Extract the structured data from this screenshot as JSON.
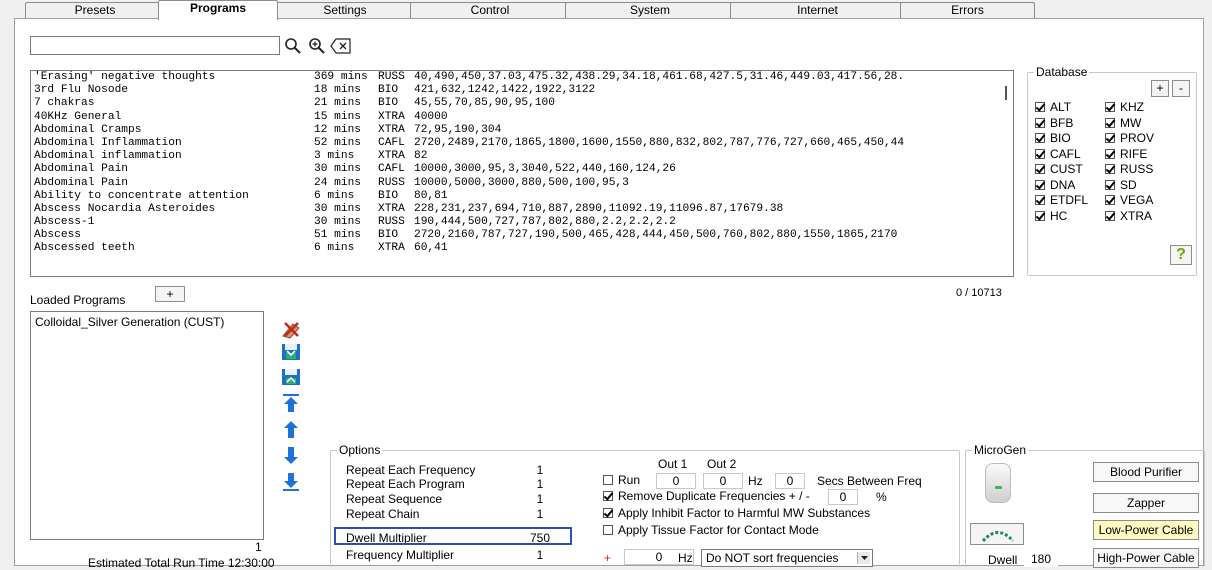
{
  "tabs": [
    {
      "label": "Presets"
    },
    {
      "label": "Programs"
    },
    {
      "label": "Settings"
    },
    {
      "label": "Control"
    },
    {
      "label": "System"
    },
    {
      "label": "Internet"
    },
    {
      "label": "Errors"
    }
  ],
  "search": {
    "value": "",
    "placeholder": ""
  },
  "programs": [
    {
      "name": "'Erasing' negative thoughts",
      "time": "369 mins",
      "db": "RUSS",
      "freqs": "40,490,450,37.03,475.32,438.29,34.18,461.68,427.5,31.46,449.03,417.56,28."
    },
    {
      "name": "3rd Flu Nosode",
      "time": "18 mins",
      "db": "BIO",
      "freqs": "421,632,1242,1422,1922,3122"
    },
    {
      "name": "7 chakras",
      "time": "21 mins",
      "db": "BIO",
      "freqs": "45,55,70,85,90,95,100"
    },
    {
      "name": "40KHz General",
      "time": "15 mins",
      "db": "XTRA",
      "freqs": "40000"
    },
    {
      "name": "Abdominal Cramps",
      "time": "12 mins",
      "db": "XTRA",
      "freqs": "72,95,190,304"
    },
    {
      "name": "Abdominal Inflammation",
      "time": "52 mins",
      "db": "CAFL",
      "freqs": "2720,2489,2170,1865,1800,1600,1550,880,832,802,787,776,727,660,465,450,44"
    },
    {
      "name": "Abdominal inflammation",
      "time": "3 mins",
      "db": "XTRA",
      "freqs": "82"
    },
    {
      "name": "Abdominal Pain",
      "time": "30 mins",
      "db": "CAFL",
      "freqs": "10000,3000,95,3,3040,522,440,160,124,26"
    },
    {
      "name": "Abdominal Pain",
      "time": "24 mins",
      "db": "RUSS",
      "freqs": "10000,5000,3000,880,500,100,95,3"
    },
    {
      "name": "Ability to concentrate attention",
      "time": "6 mins",
      "db": "BIO",
      "freqs": "80,81"
    },
    {
      "name": "Abscess Nocardia Asteroides",
      "time": "30 mins",
      "db": "XTRA",
      "freqs": "228,231,237,694,710,887,2890,11092.19,11096.87,17679.38"
    },
    {
      "name": "Abscess-1",
      "time": "30 mins",
      "db": "RUSS",
      "freqs": "190,444,500,727,787,802,880,2.2,2.2,2.2"
    },
    {
      "name": "Abscess",
      "time": "51 mins",
      "db": "BIO",
      "freqs": "2720,2160,787,727,190,500,465,428,444,450,500,760,802,880,1550,1865,2170"
    },
    {
      "name": "Abscessed teeth",
      "time": "6 mins",
      "db": "XTRA",
      "freqs": "60,41"
    }
  ],
  "count_label": "0 / 10713",
  "database": {
    "legend": "Database",
    "add_label": "+",
    "remove_label": "-",
    "help_label": "?",
    "col1": [
      {
        "label": "ALT",
        "checked": true
      },
      {
        "label": "BFB",
        "checked": true
      },
      {
        "label": "BIO",
        "checked": true
      },
      {
        "label": "CAFL",
        "checked": true
      },
      {
        "label": "CUST",
        "checked": true
      },
      {
        "label": "DNA",
        "checked": true
      },
      {
        "label": "ETDFL",
        "checked": true
      },
      {
        "label": "HC",
        "checked": true
      }
    ],
    "col2": [
      {
        "label": "KHZ",
        "checked": true
      },
      {
        "label": "MW",
        "checked": true
      },
      {
        "label": "PROV",
        "checked": true
      },
      {
        "label": "RIFE",
        "checked": true
      },
      {
        "label": "RUSS",
        "checked": true
      },
      {
        "label": "SD",
        "checked": true
      },
      {
        "label": "VEGA",
        "checked": true
      },
      {
        "label": "XTRA",
        "checked": true
      }
    ]
  },
  "loaded": {
    "title": "Loaded Programs",
    "add_label": "+",
    "items": [
      "Colloidal_Silver Generation (CUST)"
    ],
    "count": "1",
    "run_time": "Estimated Total Run Time 12:30:00"
  },
  "options": {
    "legend": "Options",
    "rows": [
      {
        "label": "Repeat Each Frequency",
        "value": "1"
      },
      {
        "label": "Repeat Each Program",
        "value": "1"
      },
      {
        "label": "Repeat Sequence",
        "value": "1"
      },
      {
        "label": "Repeat Chain",
        "value": "1"
      },
      {
        "label": "Dwell Multiplier",
        "value": "750"
      },
      {
        "label": "Frequency Multiplier",
        "value": "1"
      }
    ],
    "out1": "Out 1",
    "out2": "Out 2",
    "run_label": "Run",
    "run_out1": "0",
    "run_out2": "0",
    "hz_label": "Hz",
    "secs_value": "0",
    "secs_label": "Secs Between Freq",
    "remove_dup_label": "Remove Duplicate Frequencies + / -",
    "remove_dup_value": "0",
    "percent": "%",
    "inhibit_label": "Apply Inhibit Factor to Harmful MW Substances",
    "tissue_label": "Apply Tissue Factor for Contact Mode",
    "plus_symbol": "+",
    "offset_value": "0",
    "offset_hz": "Hz",
    "sort_value": "Do NOT sort frequencies",
    "run_checked": false,
    "remove_dup_checked": true,
    "inhibit_checked": true,
    "tissue_checked": false
  },
  "microgen": {
    "legend": "MicroGen",
    "dwell_label": "Dwell",
    "dwell_value": "180",
    "buttons": [
      "Blood Purifier",
      "Zapper",
      "Low-Power Cable",
      "High-Power Cable"
    ]
  },
  "colors": {
    "highlight": "#2f4fb0",
    "low_power_bg": "#fffac0",
    "arrow_blue": "#1e73d8"
  }
}
